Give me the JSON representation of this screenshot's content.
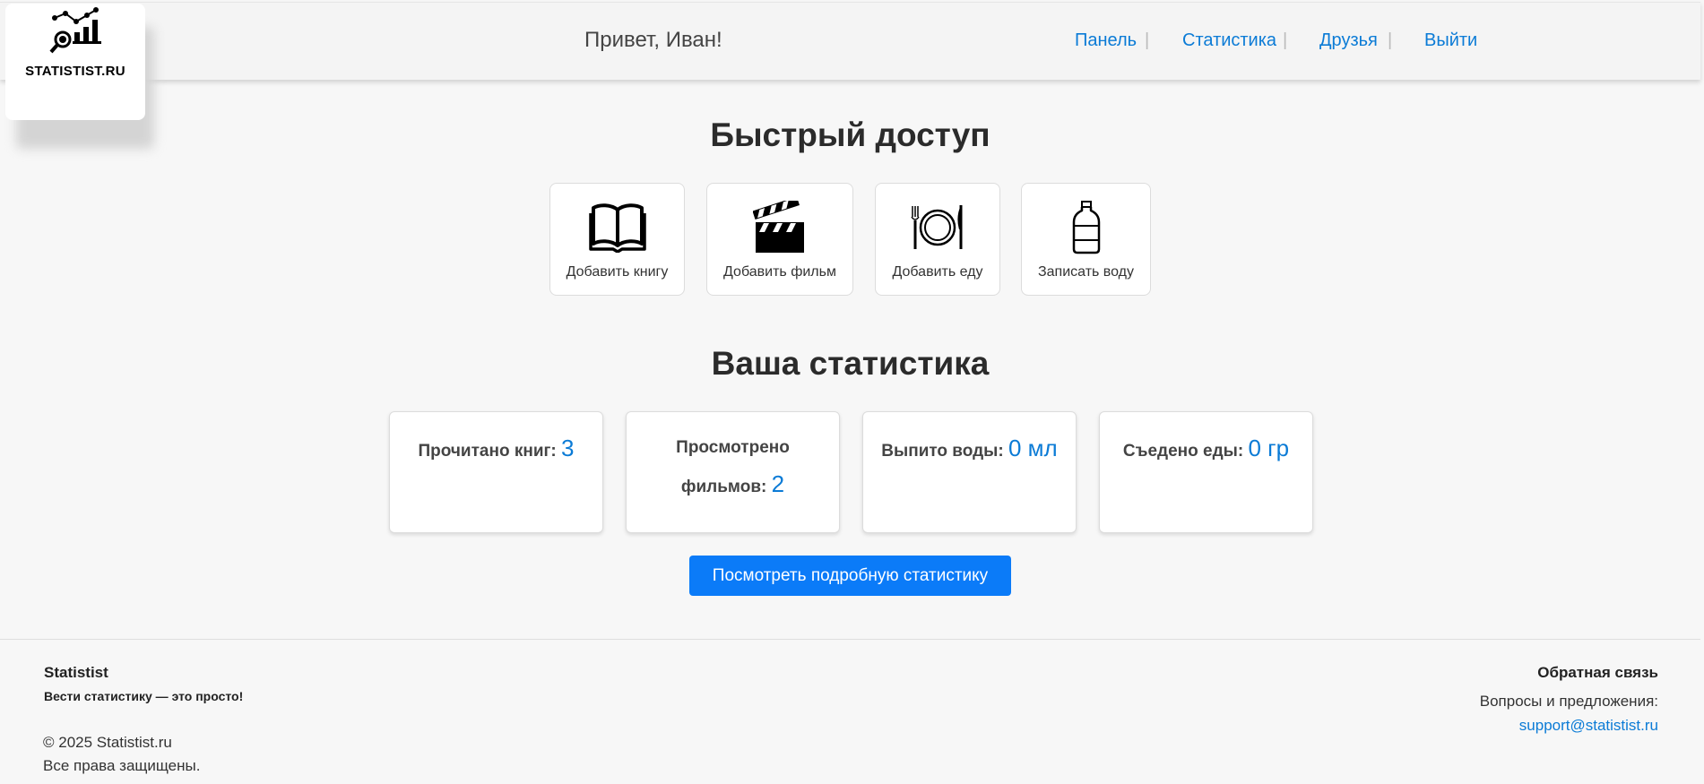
{
  "header": {
    "logo_text": "STATISTIST.RU",
    "greeting": "Привет, Иван!",
    "nav": [
      {
        "label": "Панель"
      },
      {
        "label": "Статистика"
      },
      {
        "label": "Друзья"
      },
      {
        "label": "Выйти"
      }
    ],
    "nav_separator": "|"
  },
  "quick_access": {
    "title": "Быстрый доступ",
    "items": [
      {
        "label": "Добавить книгу",
        "icon": "book-icon"
      },
      {
        "label": "Добавить фильм",
        "icon": "clapperboard-icon"
      },
      {
        "label": "Добавить еду",
        "icon": "plate-cutlery-icon"
      },
      {
        "label": "Записать воду",
        "icon": "water-bottle-icon"
      }
    ]
  },
  "stats": {
    "title": "Ваша статистика",
    "items": [
      {
        "label": "Прочитано книг:",
        "value": "3"
      },
      {
        "label": "Просмотрено фильмов:",
        "value": "2"
      },
      {
        "label": "Выпито воды:",
        "value": "0 мл"
      },
      {
        "label": "Съедено еды:",
        "value": "0 гр"
      }
    ],
    "details_button": "Посмотреть подробную статистику"
  },
  "footer": {
    "brand": "Statistist",
    "tagline": "Вести статистику — это просто!",
    "copyright": "© 2025 Statistist.ru",
    "rights": "Все права защищены.",
    "feedback_title": "Обратная связь",
    "feedback_text": "Вопросы и предложения:",
    "email": "support@statistist.ru"
  },
  "colors": {
    "accent": "#0b7bf8",
    "link": "#0b7bd6",
    "background": "#f7f7f7"
  }
}
